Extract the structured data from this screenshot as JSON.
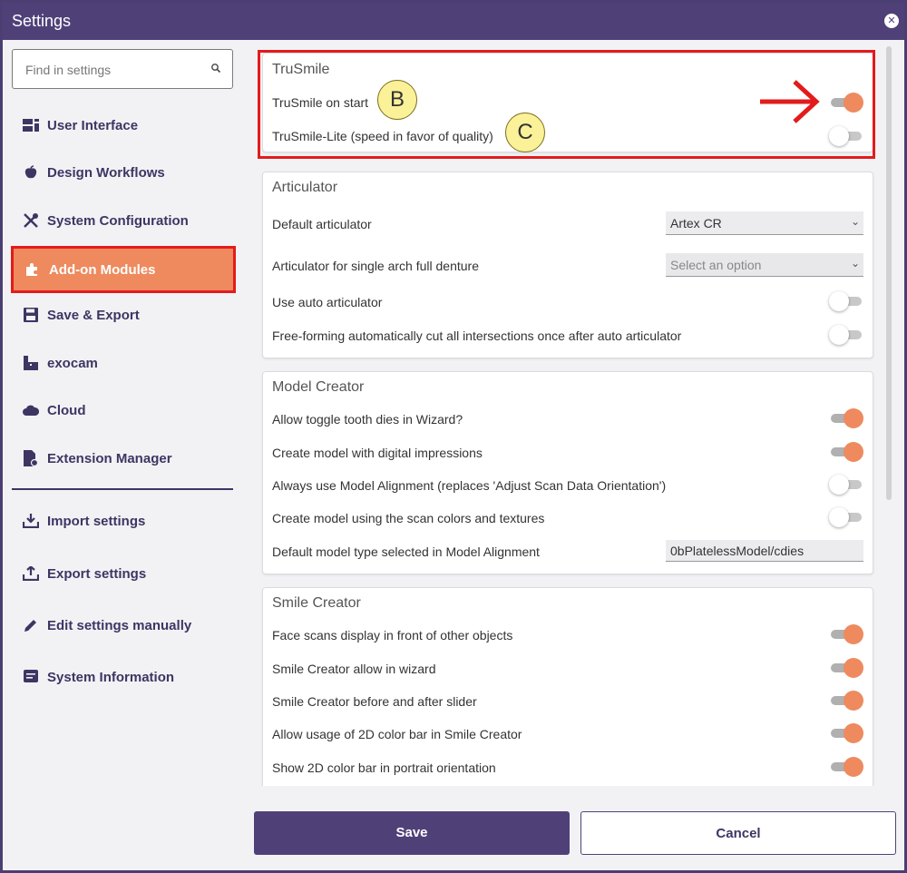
{
  "window": {
    "title": "Settings"
  },
  "search": {
    "placeholder": "Find in settings"
  },
  "sidebar": {
    "items": [
      {
        "label": "User Interface",
        "icon": "dashboard-icon"
      },
      {
        "label": "Design Workflows",
        "icon": "apple-icon"
      },
      {
        "label": "System Configuration",
        "icon": "tools-icon"
      },
      {
        "label": "Add-on Modules",
        "icon": "puzzle-icon",
        "active": true
      },
      {
        "label": "Save & Export",
        "icon": "floppy-icon"
      },
      {
        "label": "exocam",
        "icon": "camera-icon"
      },
      {
        "label": "Cloud",
        "icon": "cloud-icon"
      },
      {
        "label": "Extension Manager",
        "icon": "file-gear-icon"
      }
    ],
    "actions": [
      {
        "label": "Import settings",
        "icon": "import-icon"
      },
      {
        "label": "Export settings",
        "icon": "export-icon"
      },
      {
        "label": "Edit settings manually",
        "icon": "pencil-icon"
      },
      {
        "label": "System Information",
        "icon": "info-card-icon"
      }
    ]
  },
  "sections": {
    "trusmile": {
      "title": "TruSmile",
      "rows": [
        {
          "label": "TruSmile on start",
          "on": true
        },
        {
          "label": "TruSmile-Lite (speed in favor of quality)",
          "on": false
        }
      ]
    },
    "articulator": {
      "title": "Articulator",
      "default_label": "Default articulator",
      "default_value": "Artex CR",
      "single_arch_label": "Articulator for single arch full denture",
      "single_arch_placeholder": "Select an option",
      "rows": [
        {
          "label": "Use auto articulator",
          "on": false
        },
        {
          "label": "Free-forming automatically cut all intersections once after auto articulator",
          "on": false
        }
      ]
    },
    "model_creator": {
      "title": "Model Creator",
      "rows": [
        {
          "label": "Allow toggle tooth dies in Wizard?",
          "on": true
        },
        {
          "label": "Create model with digital impressions",
          "on": true
        },
        {
          "label": "Always use Model Alignment (replaces 'Adjust Scan Data Orientation')",
          "on": false
        },
        {
          "label": "Create model using the scan colors and textures",
          "on": false
        }
      ],
      "default_type_label": "Default model type selected in Model Alignment",
      "default_type_value": "0bPlatelessModel/cdies"
    },
    "smile_creator": {
      "title": "Smile Creator",
      "rows": [
        {
          "label": "Face scans display in front of other objects",
          "on": true
        },
        {
          "label": "Smile Creator allow in wizard",
          "on": true
        },
        {
          "label": "Smile Creator before and after slider",
          "on": true
        },
        {
          "label": "Allow usage of 2D color bar in Smile Creator",
          "on": true
        },
        {
          "label": "Show 2D color bar in portrait orientation",
          "on": true
        }
      ]
    }
  },
  "annotations": {
    "callout_b": "B",
    "callout_c": "C"
  },
  "footer": {
    "save_label": "Save",
    "cancel_label": "Cancel"
  },
  "colors": {
    "accent": "#ee8a5e",
    "brand": "#4f4178",
    "highlight": "#e31b1b"
  }
}
